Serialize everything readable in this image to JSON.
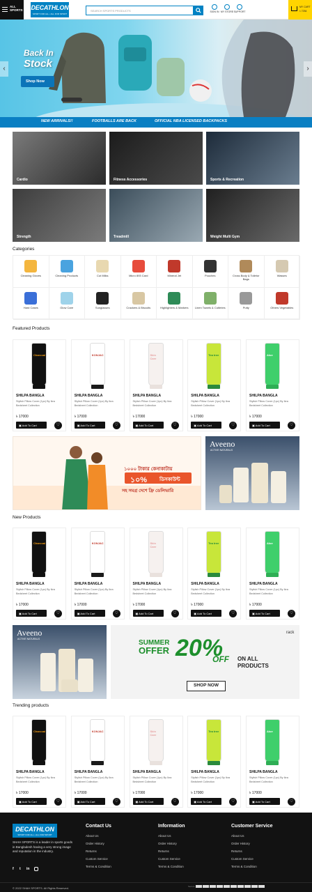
{
  "header": {
    "all_sports": [
      "ALL",
      "SPORTS"
    ],
    "logo": {
      "wordmark": "DECATHLON",
      "tagline": "SPORT FOR ALL • ALL FOR SPORT"
    },
    "search_placeholder": "SEARCH SPORTS PRODUCTS",
    "icons": [
      {
        "label": "SIGN IN",
        "icon": "user-icon"
      },
      {
        "label": "MY STORE",
        "icon": "store-icon"
      },
      {
        "label": "SUPPORT",
        "icon": "support-icon"
      }
    ],
    "cart": {
      "title": "MY CART",
      "amount": "৳ 7254"
    }
  },
  "hero": {
    "title_line1": "Back In",
    "title_line2": "Stock",
    "button": "Shop Now",
    "prev": "‹",
    "next": "›"
  },
  "promo_bar": [
    "NEW ARRIVALS!!",
    "FOOTBALLS ARE BACK",
    "OFFICIAL NBA LICENSED BACKPACKS"
  ],
  "tiles": [
    "Cardio",
    "Fitness Accessories",
    "Sports & Recreation",
    "Strength",
    "Treadmill",
    "Weight Multi Gym"
  ],
  "categories": {
    "title": "Categories",
    "items": [
      "Cleaning Gloves",
      "Cleaning Products",
      "Cut Milks",
      "Micro 893 Card",
      "Mineral Jet",
      "Pouches",
      "Cross Body & Toiletor Bags",
      "Wasses",
      "Hard Cases",
      "Glow Care",
      "Sunglasses",
      "Crackers & Biscuits",
      "Highlighters & Markers",
      "Linen Towels & Cutleries",
      "Putty",
      "Others Vegetables"
    ]
  },
  "product": {
    "name": "SHILPA BANGLA",
    "desc": "Stylish Pillow Cover (1pc) By Ikra Bedsheet Collection",
    "price": "৳ 17000",
    "add": "Add To Cart",
    "brands": [
      "Charcoal",
      "KONJAC",
      "Skin Care",
      "Tea tree",
      "Aloe"
    ]
  },
  "sections": {
    "featured": "Featured Products",
    "new": "New Products",
    "trending": "Trending products"
  },
  "banners": {
    "bengali_line1": "১০০০ টাকার কেনাকাটায়",
    "bengali_pct": "১০%",
    "bengali_disc": "ডিসকাউন্ট",
    "bengali_line3": "সহ সমগ্র দেশে ফ্রি ডেলিভারি",
    "aveeno": "Aveeno",
    "aveeno_sub": "ACTIVE NATURALS",
    "summer1": "SUMMER",
    "summer2": "OFFER",
    "summer_pct": "20%",
    "summer_off": "OFF",
    "summer_on1": "ON ALL",
    "summer_on2": "PRODUCTS",
    "shop_now": "SHOP NOW",
    "rack": "rack"
  },
  "footer": {
    "logo": {
      "wordmark": "DECATHLON",
      "tagline": "SPORT FOR ALL • ALL FOR SPORT"
    },
    "about": "SHAH SPORTS is a leader in sports goods in Bangladesh having a very strong image and reputation in the industry.",
    "columns": [
      {
        "title": "Contact Us",
        "links": [
          "About Us",
          "Order History",
          "Returns",
          "Custom Service",
          "Terms & Condition"
        ]
      },
      {
        "title": "Information",
        "links": [
          "About Us",
          "Order History",
          "Returns",
          "Custom Service",
          "Terms & Condition"
        ]
      },
      {
        "title": "Customer Service",
        "links": [
          "About Us",
          "Order History",
          "Returns",
          "Custom Service",
          "Terms & Condition"
        ]
      }
    ],
    "copyright": "© 2022 SHAH SPORTS. All Rights Reserved.",
    "payment_label": "Secure"
  },
  "colors": {
    "brand": "#0082c3",
    "promo_bar": "#0a7fc3",
    "cart": "#ffd400",
    "footer": "#121212"
  }
}
